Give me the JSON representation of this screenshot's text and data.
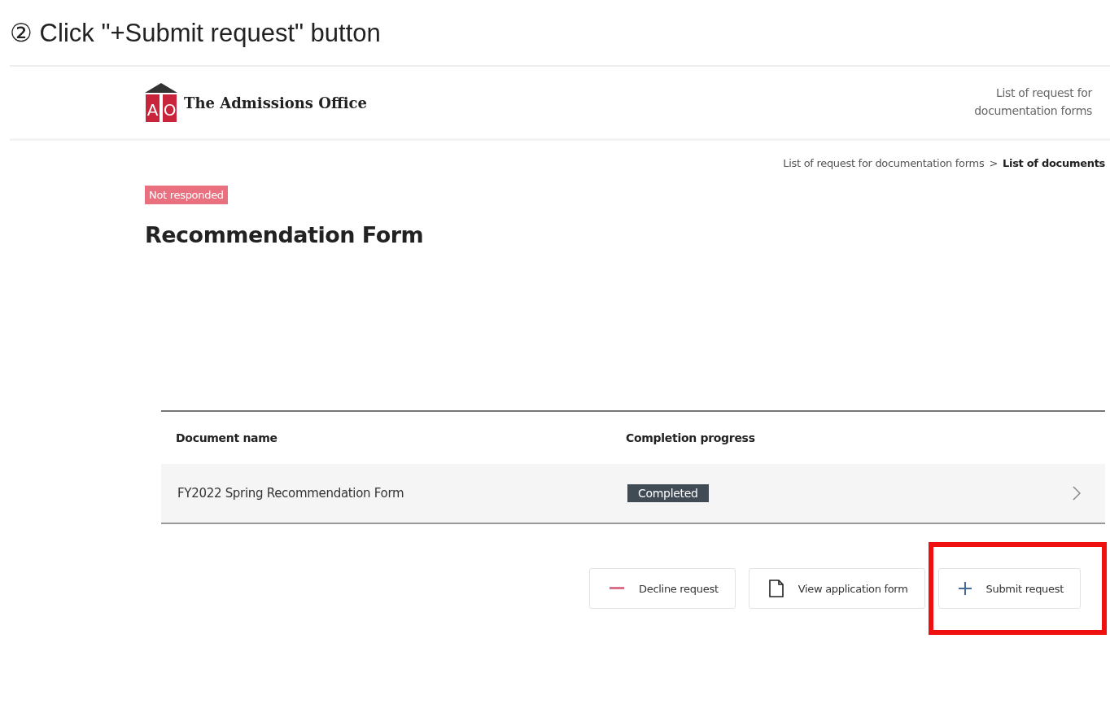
{
  "caption": "② Click \"+Submit request\" button",
  "header": {
    "logo_letters": [
      "A",
      "O"
    ],
    "brand": "The Admissions Office",
    "nav_link": "List of request for documentation forms"
  },
  "breadcrumb": [
    {
      "label": "List of request for documentation forms",
      "selected": false
    },
    {
      "label": "List of documents",
      "selected": true
    }
  ],
  "breadcrumb_separator": ">",
  "status_badge": "Not responded",
  "title": "Recommendation Form",
  "table": {
    "columns": [
      "Document name",
      "Completion progress"
    ],
    "rows": [
      {
        "name": "FY2022 Spring Recommendation Form",
        "status": "Completed"
      }
    ]
  },
  "buttons": [
    {
      "kind": "decline",
      "label": "Decline request",
      "highlighted": false
    },
    {
      "kind": "view",
      "label": "View application form",
      "highlighted": false
    },
    {
      "kind": "submit",
      "label": "Submit request",
      "highlighted": true
    }
  ]
}
